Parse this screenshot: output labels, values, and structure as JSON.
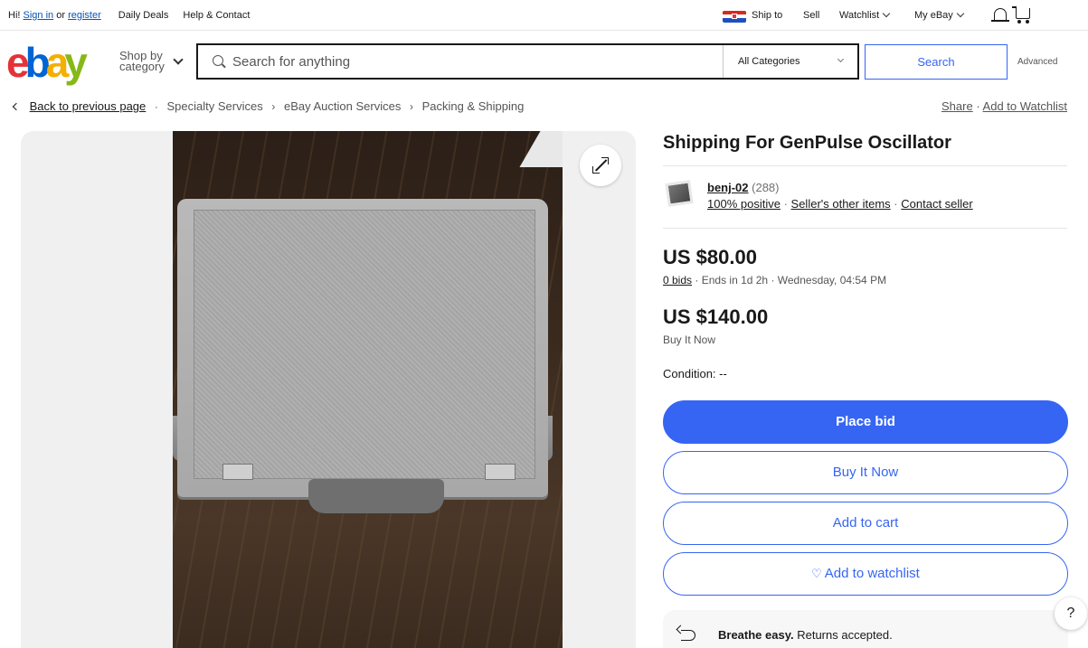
{
  "topbar": {
    "greeting_prefix": "Hi!",
    "sign_in": "Sign in",
    "or": "or",
    "register": "register",
    "daily_deals": "Daily Deals",
    "help_contact": "Help & Contact",
    "ship_to": "Ship to",
    "sell": "Sell",
    "watchlist": "Watchlist",
    "my_ebay": "My eBay"
  },
  "header": {
    "logo": {
      "e": "e",
      "b": "b",
      "a": "a",
      "y": "y"
    },
    "shop_by_line1": "Shop by",
    "shop_by_line2": "category",
    "search_placeholder": "Search for anything",
    "category_selected": "All Categories",
    "search_button": "Search",
    "advanced": "Advanced"
  },
  "breadcrumb": {
    "back": "Back to previous page",
    "items": [
      "Specialty Services",
      "eBay Auction Services",
      "Packing & Shipping"
    ],
    "share": "Share",
    "add_to_watchlist": "Add to Watchlist"
  },
  "listing": {
    "title": "Shipping For GenPulse Oscillator",
    "seller": {
      "name": "benj-02",
      "feedback_count": "(288)",
      "positive": "100% positive",
      "other_items": "Seller's other items",
      "contact": "Contact seller"
    },
    "auction_price": "US $80.00",
    "bids": "0 bids",
    "ends": "Ends in 1d 2h · Wednesday, 04:54 PM",
    "bin_price": "US $140.00",
    "bin_label": "Buy It Now",
    "condition": "Condition: --",
    "buttons": {
      "place_bid": "Place bid",
      "buy_it_now": "Buy It Now",
      "add_to_cart": "Add to cart",
      "add_to_watchlist": "Add to watchlist"
    },
    "returns_bold": "Breathe easy.",
    "returns_rest": "Returns accepted."
  },
  "help": "?",
  "colors": {
    "primary": "#3665f3",
    "logo_e": "#e53238",
    "logo_b": "#0064d2",
    "logo_a": "#f5af02",
    "logo_y": "#86b817"
  }
}
